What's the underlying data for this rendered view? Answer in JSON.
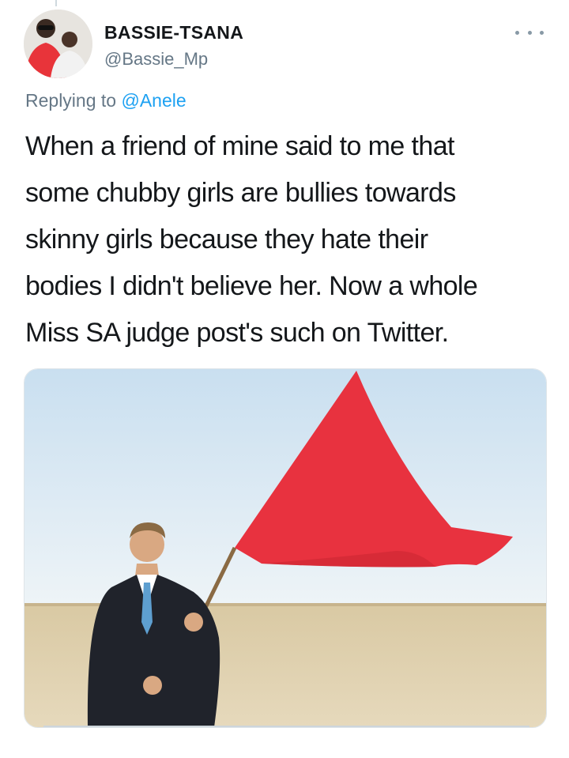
{
  "tweet": {
    "display_name": "BASSIE-TSANA",
    "handle": "@Bassie_Mp",
    "reply_prefix": "Replying to",
    "reply_to": "@Anele",
    "text": "When a friend of mine said to me that\nsome chubby girls are bullies towards\nskinny girls because they hate their\nbodies I didn't believe her. Now a whole\nMiss SA judge post's such on Twitter."
  },
  "icons": {
    "more": "more-horizontal-icon",
    "avatar": "profile-avatar"
  },
  "colors": {
    "link": "#1da1f2",
    "muted": "#657786",
    "text": "#14171a",
    "flag": "#e8323f"
  }
}
